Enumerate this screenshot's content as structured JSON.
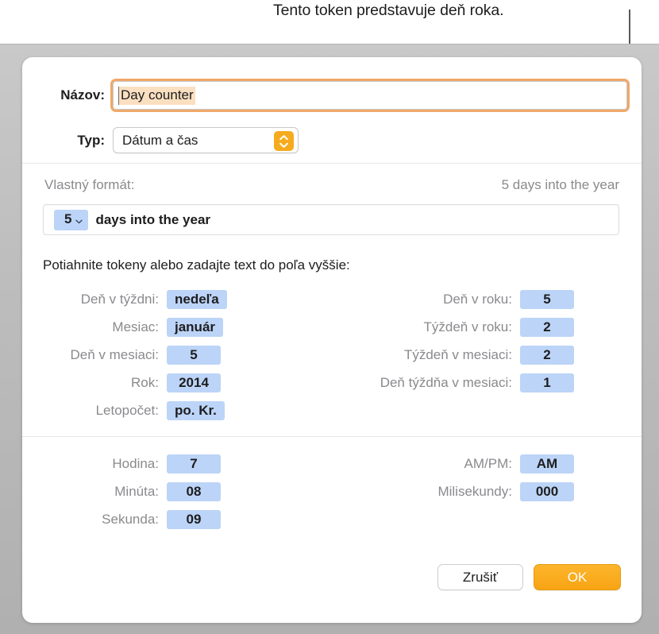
{
  "annotation": {
    "text": "Tento token predstavuje deň roka."
  },
  "dialog": {
    "name_field": {
      "label": "Názov:",
      "value": "Day counter",
      "placeholder": "Názov"
    },
    "type_field": {
      "label": "Typ:",
      "value": "Dátum a čas",
      "stepper_icon": "up-down-chevron-icon"
    },
    "custom_format": {
      "label": "Vlastný formát:",
      "preview": "5 days into the year",
      "field": {
        "token": {
          "value": "5",
          "chevron_icon": "chevron-down-icon"
        },
        "static_text": "days into the year"
      }
    },
    "drag_hint": "Potiahnite tokeny alebo zadajte text do poľa vyššie:",
    "date_tokens": {
      "left": [
        {
          "label": "Deň v týždni:",
          "value": "nedeľa"
        },
        {
          "label": "Mesiac:",
          "value": "január"
        },
        {
          "label": "Deň v mesiaci:",
          "value": "5"
        },
        {
          "label": "Rok:",
          "value": "2014"
        },
        {
          "label": "Letopočet:",
          "value": "po. Kr."
        }
      ],
      "right": [
        {
          "label": "Deň v roku:",
          "value": "5"
        },
        {
          "label": "Týždeň v roku:",
          "value": "2"
        },
        {
          "label": "Týždeň v mesiaci:",
          "value": "2"
        },
        {
          "label": "Deň týždňa v mesiaci:",
          "value": "1"
        }
      ]
    },
    "time_tokens": {
      "left": [
        {
          "label": "Hodina:",
          "value": "7"
        },
        {
          "label": "Minúta:",
          "value": "08"
        },
        {
          "label": "Sekunda:",
          "value": "09"
        }
      ],
      "right": [
        {
          "label": "AM/PM:",
          "value": "AM"
        },
        {
          "label": "Milisekundy:",
          "value": "000"
        }
      ]
    },
    "buttons": {
      "cancel": "Zrušiť",
      "ok": "OK"
    }
  },
  "colors": {
    "token_blue": "#bcd4f7",
    "accent_orange": "#f6ab1e",
    "focus_ring": "#f0a868",
    "selection_peach": "#fadfc0",
    "label_gray": "#8a8a8e",
    "callout_line": "#59595b"
  }
}
